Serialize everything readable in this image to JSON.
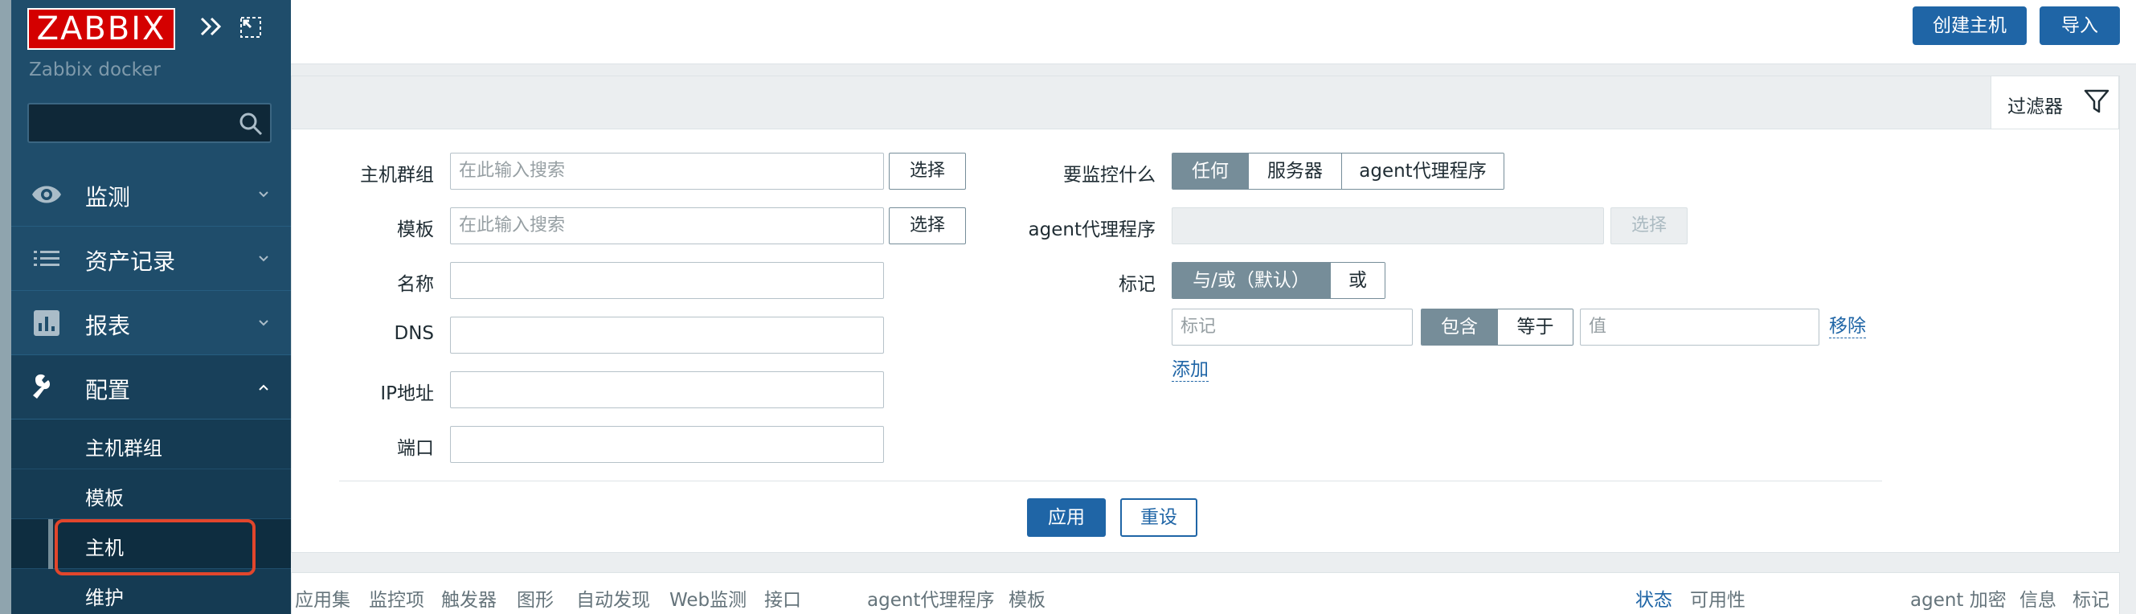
{
  "sidebar": {
    "logo": "ZABBIX",
    "server_name": "Zabbix docker",
    "search_value": "",
    "menu": [
      {
        "label": "监测",
        "icon": "eye-icon"
      },
      {
        "label": "资产记录",
        "icon": "list-icon"
      },
      {
        "label": "报表",
        "icon": "bar-chart-icon"
      },
      {
        "label": "配置",
        "icon": "wrench-icon"
      }
    ],
    "submenu": [
      "主机群组",
      "模板",
      "主机",
      "维护"
    ]
  },
  "header": {
    "create_host": "创建主机",
    "import": "导入"
  },
  "filter": {
    "tab_label": "过滤器",
    "host_groups_label": "主机群组",
    "host_groups_placeholder": "在此输入搜索",
    "templates_label": "模板",
    "templates_placeholder": "在此输入搜索",
    "select_label": "选择",
    "name_label": "名称",
    "dns_label": "DNS",
    "ip_label": "IP地址",
    "port_label": "端口",
    "monitored_by_label": "要监控什么",
    "monitored_by_options": [
      "任何",
      "服务器",
      "agent代理程序"
    ],
    "monitored_by_selected": "任何",
    "proxy_label": "agent代理程序",
    "tags_label": "标记",
    "tags_mode_options": [
      "与/或（默认）",
      "或"
    ],
    "tags_mode_selected": "与/或（默认）",
    "tag_placeholder": "标记",
    "tag_operator_options": [
      "包含",
      "等于"
    ],
    "tag_operator_selected": "包含",
    "value_placeholder": "值",
    "remove_link": "移除",
    "add_link": "添加",
    "apply": "应用",
    "reset": "重设"
  },
  "table": {
    "columns_left": [
      "应用集",
      "监控项",
      "触发器",
      "图形",
      "自动发现",
      "Web监测",
      "接口"
    ],
    "col_proxy": "agent代理程序",
    "col_templates": "模板",
    "col_status": "状态",
    "col_availability": "可用性",
    "col_encryption": "agent 加密",
    "col_info": "信息",
    "col_tags": "标记"
  },
  "colors": {
    "sidebar_bg": "#1f4d6b",
    "accent_blue": "#1f65a6",
    "logo_red": "#d40000",
    "highlight_red": "#e2462c",
    "segment_selected": "#768d99"
  }
}
